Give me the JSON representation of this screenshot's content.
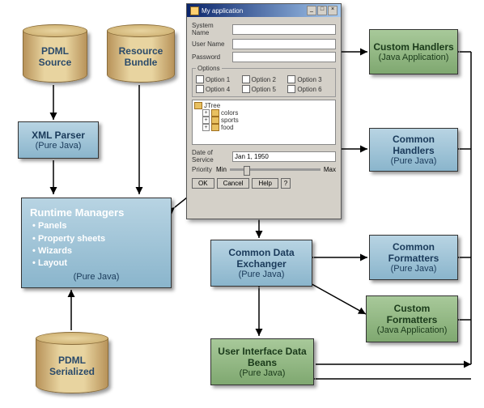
{
  "cylinders": {
    "pdml_source": {
      "line1": "PDML",
      "line2": "Source"
    },
    "resource_bundle": {
      "line1": "Resource",
      "line2": "Bundle"
    },
    "pdml_serialized": {
      "line1": "PDML",
      "line2": "Serialized"
    }
  },
  "boxes": {
    "xml_parser": {
      "title": "XML Parser",
      "sub": "(Pure Java)"
    },
    "runtime_managers": {
      "title": "Runtime Managers",
      "bullets": [
        "Panels",
        "Property sheets",
        "Wizards",
        "Layout"
      ],
      "sub": "(Pure Java)"
    },
    "custom_handlers": {
      "title": "Custom Handlers",
      "sub": "(Java Application)"
    },
    "common_handlers": {
      "title": "Common Handlers",
      "sub": "(Pure Java)"
    },
    "common_data_exchanger": {
      "title": "Common Data Exchanger",
      "sub": "(Pure Java)"
    },
    "common_formatters": {
      "title": "Common Formatters",
      "sub": "(Pure Java)"
    },
    "custom_formatters": {
      "title": "Custom Formatters",
      "sub": "(Java Application)"
    },
    "ui_data_beans": {
      "title": "User Interface Data Beans",
      "sub": "(Pure Java)"
    }
  },
  "dialog": {
    "title": "My application",
    "fields": {
      "system_name": "System Name",
      "user_name": "User Name",
      "password": "Password"
    },
    "options_label": "Options",
    "options": [
      "Option 1",
      "Option 2",
      "Option 3",
      "Option 4",
      "Option 5",
      "Option 6"
    ],
    "tree_root": "JTree",
    "tree_items": [
      "colors",
      "sports",
      "food"
    ],
    "date_label": "Date of Service",
    "date_value": "Jan 1, 1950",
    "priority_label": "Priority",
    "min_label": "Min",
    "max_label": "Max",
    "buttons": {
      "ok": "OK",
      "cancel": "Cancel",
      "help": "Help",
      "q": "?"
    }
  }
}
